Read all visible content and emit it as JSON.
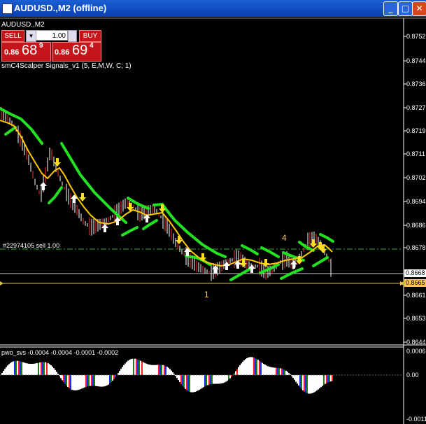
{
  "window": {
    "title": "AUDUSD.,M2 (offline)",
    "minimize_glyph": "_",
    "restore_glyph": "□",
    "close_glyph": "✕"
  },
  "chart": {
    "symbol_label": "AUDUSD.,M2",
    "indicator_label": "smC4Scalper Signals_v1 (5, E,M,W, C; 1)",
    "order_label": "#22974105 sell 1.00",
    "marker_1": "1",
    "marker_4": "4",
    "subwindow_label": "pwo_svs -0.0004 -0.0004 -0.0001 -0.0002"
  },
  "trade_panel": {
    "sell_label": "SELL",
    "buy_label": "BUY",
    "lot_value": "1.00",
    "sell_price_small": "0.86",
    "sell_price_big": "68",
    "sell_price_sup": "9",
    "buy_price_small": "0.86",
    "buy_price_big": "69",
    "buy_price_sup": "4"
  },
  "price_axis": {
    "labels": [
      "0.8752",
      "0.8744",
      "0.8736",
      "0.8727",
      "0.8719",
      "0.8711",
      "0.8702",
      "0.8694",
      "0.8686",
      "0.8678",
      "0.8661",
      "0.8653",
      "0.8644"
    ],
    "bid_tag": "0.8668",
    "line_tag": "0.8665"
  },
  "sub_axis": {
    "labels": [
      "0.0006",
      "0.00",
      "-0.0011"
    ]
  },
  "colors": {
    "bull_bar": "#ffffff",
    "bear_bar": "#ff2b2b",
    "upper_band": "#22e022",
    "lower_band": "#22e022",
    "middle_line": "#ffc800",
    "arrow_down": "#ffe020",
    "arrow_up": "#ffffff",
    "order_line": "#33aa33",
    "horizontal_line": "#d9c24a"
  }
}
